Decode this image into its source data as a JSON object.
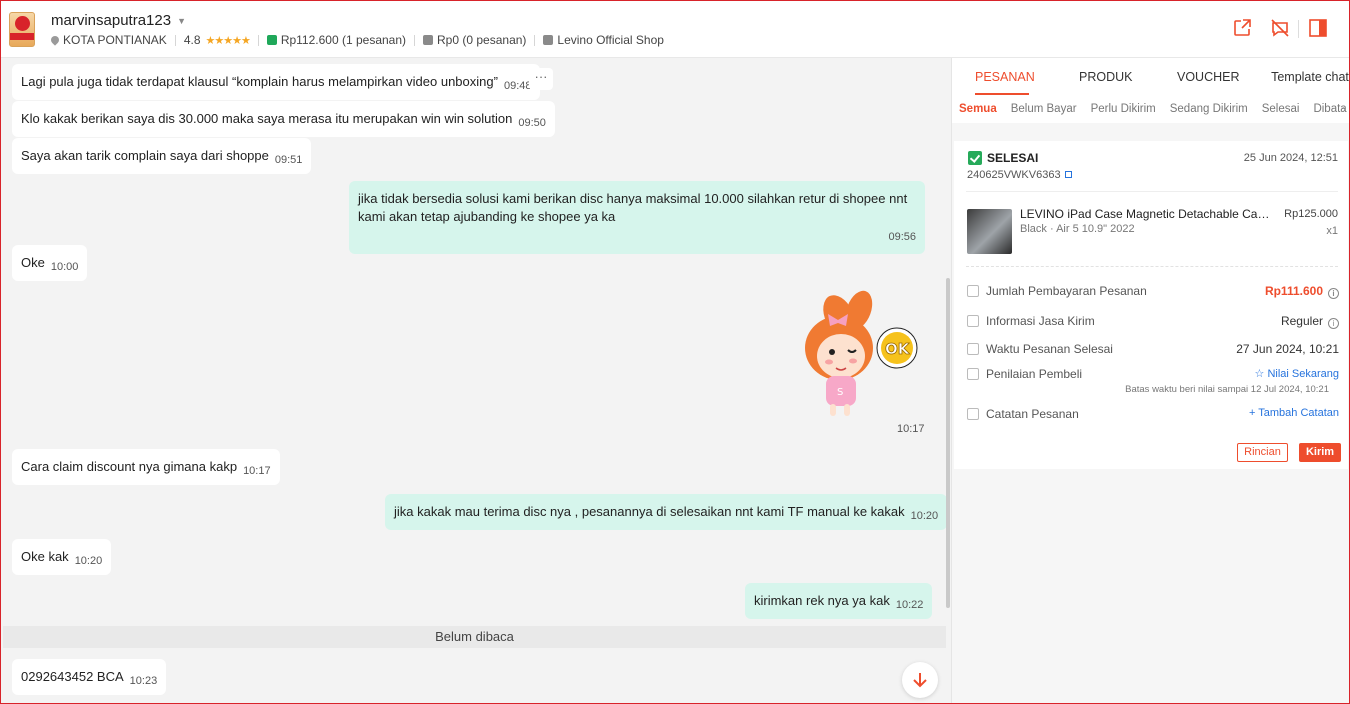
{
  "header": {
    "username": "marvinsaputra123",
    "location": "KOTA PONTIANAK",
    "rating": "4.8",
    "stars": "★★★★★",
    "paid_orders": "Rp112.600 (1 pesanan)",
    "pending_orders": "Rp0 (0 pesanan)",
    "shop_name": "Levino Official Shop"
  },
  "messages": [
    {
      "dir": "in",
      "text": "Lagi pula juga tidak terdapat klausul “komplain harus melampirkan video unboxing”",
      "time": "09:48"
    },
    {
      "dir": "in",
      "text": "Klo kakak berikan saya dis 30.000 maka saya merasa itu merupakan win win solution",
      "time": "09:50"
    },
    {
      "dir": "in",
      "text": "Saya akan tarik complain saya dari shoppe",
      "time": "09:51"
    },
    {
      "dir": "out",
      "line1": "jika tidak bersedia solusi kami berikan disc hanya maksimal 10.000 silahkan retur di shopee nnt",
      "line2": "kami akan tetap ajubanding ke shopee ya ka",
      "time": "09:56"
    },
    {
      "dir": "in",
      "text": "Oke",
      "time": "10:00"
    },
    {
      "dir": "sticker",
      "time": "10:17"
    },
    {
      "dir": "in",
      "text": "Cara claim discount nya gimana kakp",
      "time": "10:17"
    },
    {
      "dir": "out",
      "text": "jika kakak mau terima disc nya , pesanannya di selesaikan nnt kami TF manual ke kakak",
      "time": "10:20"
    },
    {
      "dir": "in",
      "text": "Oke kak",
      "time": "10:20"
    },
    {
      "dir": "out",
      "text": "kirimkan rek nya ya kak",
      "time": "10:22"
    },
    {
      "dir": "in",
      "text": "0292643452 BCA",
      "time": "10:23"
    }
  ],
  "unread_label": "Belum dibaca",
  "panel": {
    "tabs": [
      "PESANAN",
      "PRODUK",
      "VOUCHER",
      "Template chat"
    ],
    "subtabs": [
      "Semua",
      "Belum Bayar",
      "Perlu Dikirim",
      "Sedang Dikirim",
      "Selesai",
      "Dibata"
    ],
    "order": {
      "status": "SELESAI",
      "date": "25 Jun 2024, 12:51",
      "id": "240625VWKV6363",
      "product_name": "LEVINO iPad Case Magnetic Detachable Case...",
      "product_variant": "Black · Air 5 10.9\" 2022",
      "product_price": "Rp125.000",
      "product_qty": "x1",
      "rows": {
        "payment_label": "Jumlah Pembayaran Pesanan",
        "payment_value": "Rp111.600",
        "shipping_label": "Informasi Jasa Kirim",
        "shipping_value": "Reguler",
        "completed_label": "Waktu Pesanan Selesai",
        "completed_value": "27 Jun 2024, 10:21",
        "review_label": "Penilaian Pembeli",
        "review_value": "☆ Nilai Sekarang",
        "review_note": "Batas waktu beri nilai sampai 12 Jul 2024, 10:21",
        "note_label": "Catatan Pesanan",
        "note_value": "+ Tambah Catatan"
      },
      "btn_detail": "Rincian",
      "btn_send": "Kirim"
    }
  },
  "colors": {
    "accent": "#ee4d2d",
    "out_bubble": "#d6f5ec",
    "chat_bg": "#f3f3f3"
  }
}
